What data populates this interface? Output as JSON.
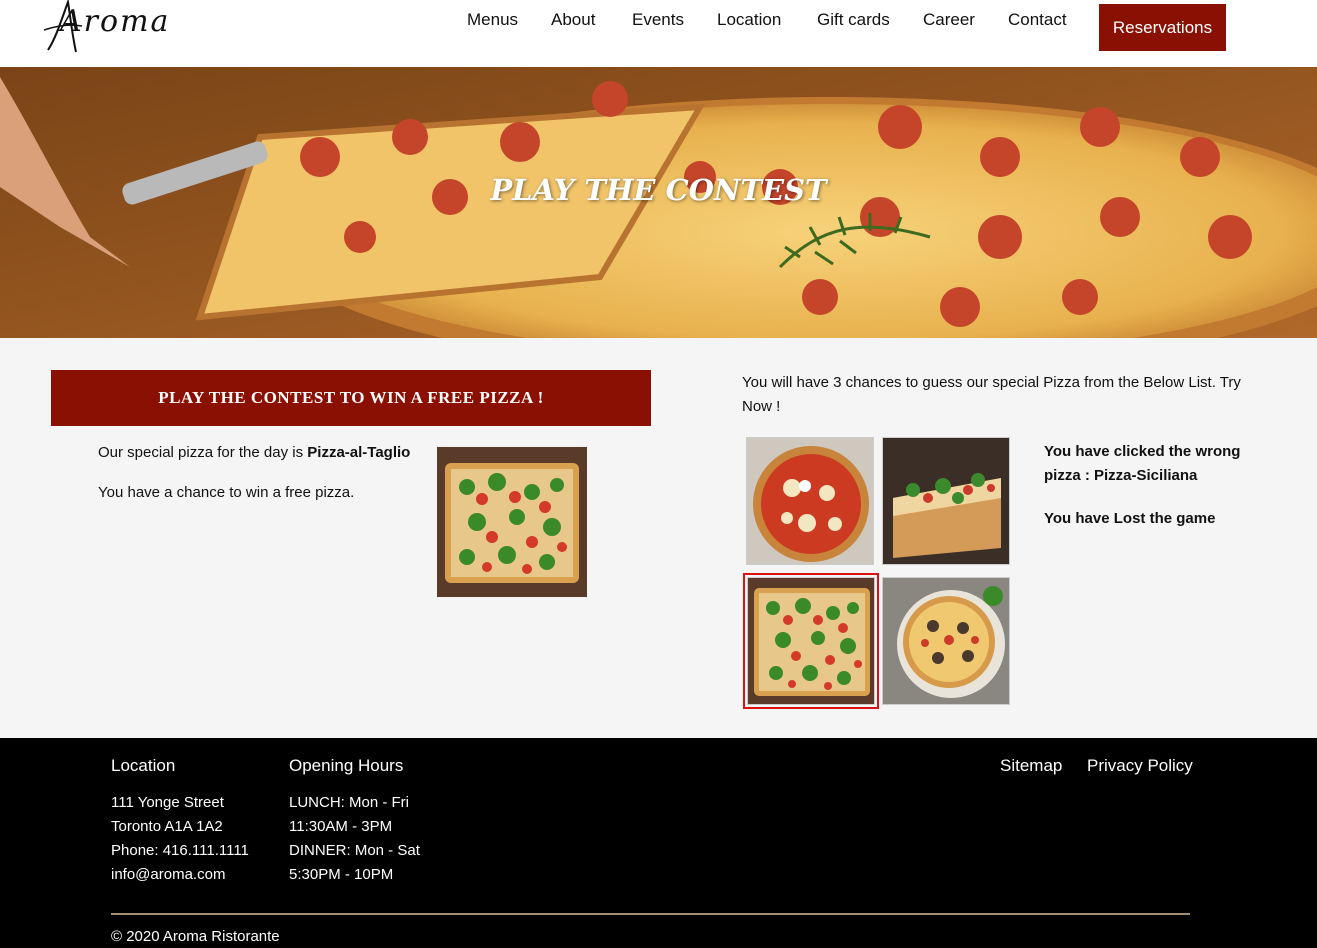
{
  "header": {
    "logo_text": "Aroma",
    "nav": [
      "Menus",
      "About",
      "Events",
      "Location",
      "Gift cards",
      "Career",
      "Contact"
    ],
    "reserve_label": "Reservations"
  },
  "hero": {
    "title": "PLAY THE CONTEST"
  },
  "contest": {
    "banner": "PLAY THE CONTEST TO WIN A FREE PIZZA !",
    "special_prefix": "Our special pizza for the day is ",
    "special_name": "Pizza-al-Taglio",
    "chance_text": "You have a chance to win a free pizza.",
    "instructions": "You will have 3 chances to guess our special Pizza from the Below List. Try Now !",
    "pizzas": [
      {
        "name": "Margherita",
        "image": "margherita-pizza"
      },
      {
        "name": "Pizza-Siciliana",
        "image": "stuffed-pizza-slice"
      },
      {
        "name": "Pizza-al-Taglio",
        "image": "tomato-arugula-pizza",
        "selected": true
      },
      {
        "name": "Mushroom",
        "image": "mushroom-pizza"
      }
    ],
    "result_wrong": "You have clicked the wrong pizza : Pizza-Siciliana",
    "result_lost": "You have Lost the game"
  },
  "footer": {
    "location_title": "Location",
    "location_lines": [
      "111 Yonge Street",
      "Toronto A1A 1A2",
      "Phone: 416.111.1111",
      "info@aroma.com"
    ],
    "hours_title": "Opening Hours",
    "hours_lines": [
      "LUNCH: Mon - Fri",
      "11:30AM - 3PM",
      "DINNER: Mon - Sat",
      "5:30PM - 10PM"
    ],
    "sitemap": "Sitemap",
    "privacy": "Privacy Policy",
    "copyright": "© 2020 Aroma Ristorante"
  },
  "colors": {
    "brand_red": "#8b1004",
    "footer_bg": "#000000",
    "page_bg": "#f5f5f5"
  }
}
